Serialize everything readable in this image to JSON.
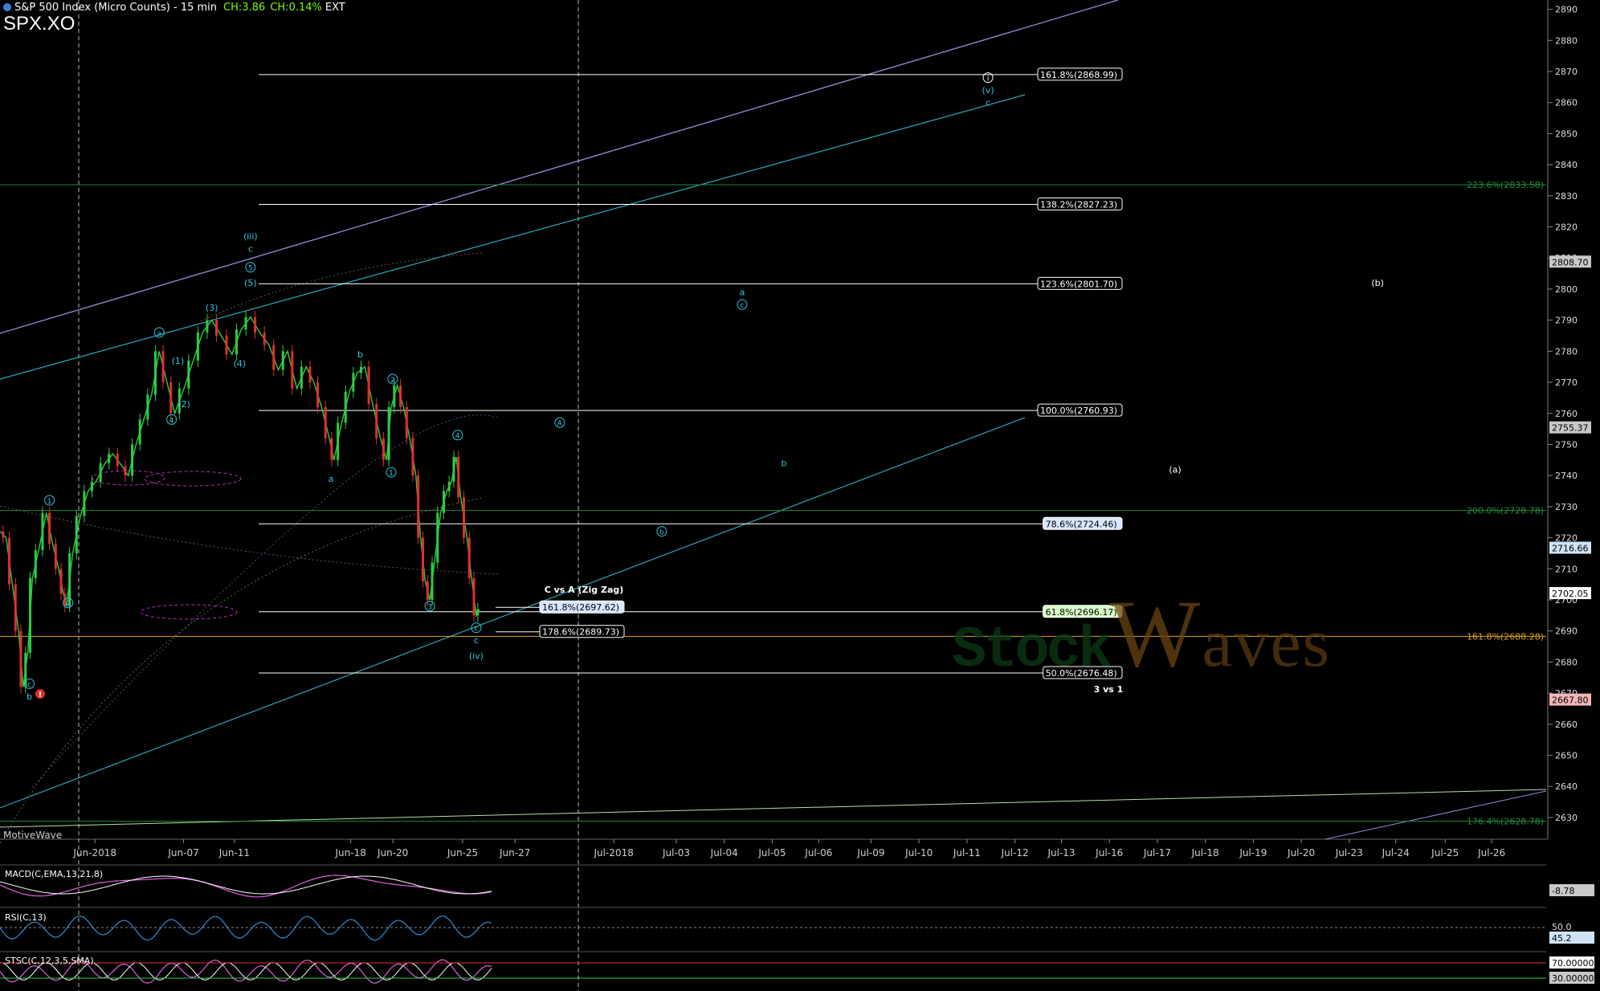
{
  "header": {
    "title": "S&P 500 Index (Micro Counts) - 15 min",
    "change": "CH:3.86",
    "change_pct": "CH:0.14%",
    "session": "EXT",
    "symbol": "SPX.XO"
  },
  "watermark": "MotiveWave",
  "brand": {
    "part1": "Stock",
    "part2": "aves",
    "w": "W"
  },
  "colors": {
    "up": "#2ecc40",
    "down": "#e0302a",
    "wave": "#2ec7e0",
    "fib": "#ffffff",
    "green_line": "#1f8c3a",
    "orange_line": "#d9a21b"
  },
  "chart_data": {
    "type": "line",
    "title": "S&P 500 Index (Micro Counts) - 15 min",
    "ylim": [
      2623,
      2893
    ],
    "y_ticks": [
      2630,
      2640,
      2650,
      2660,
      2670,
      2680,
      2690,
      2700,
      2710,
      2720,
      2730,
      2740,
      2750,
      2760,
      2770,
      2780,
      2790,
      2800,
      2810,
      2820,
      2830,
      2840,
      2850,
      2860,
      2870,
      2880,
      2890
    ],
    "x_ticks": [
      "Jun-2018",
      "Jun-07",
      "Jun-11",
      "Jun-18",
      "Jun-20",
      "Jun-25",
      "Jun-27",
      "Jul-2018",
      "Jul-03",
      "Jul-04",
      "Jul-05",
      "Jul-06",
      "Jul-09",
      "Jul-10",
      "Jul-11",
      "Jul-12",
      "Jul-13",
      "Jul-16",
      "Jul-17",
      "Jul-18",
      "Jul-19",
      "Jul-20",
      "Jul-23",
      "Jul-24",
      "Jul-25",
      "Jul-26"
    ],
    "price_path": [
      [
        0.0,
        2722
      ],
      [
        0.004,
        2720
      ],
      [
        0.008,
        2705
      ],
      [
        0.012,
        2690
      ],
      [
        0.015,
        2672
      ],
      [
        0.018,
        2683
      ],
      [
        0.021,
        2707
      ],
      [
        0.025,
        2716
      ],
      [
        0.03,
        2728
      ],
      [
        0.034,
        2718
      ],
      [
        0.038,
        2710
      ],
      [
        0.041,
        2702
      ],
      [
        0.043,
        2698
      ],
      [
        0.047,
        2715
      ],
      [
        0.052,
        2727
      ],
      [
        0.057,
        2735
      ],
      [
        0.062,
        2738
      ],
      [
        0.068,
        2744
      ],
      [
        0.073,
        2747
      ],
      [
        0.079,
        2743
      ],
      [
        0.083,
        2740
      ],
      [
        0.088,
        2750
      ],
      [
        0.093,
        2758
      ],
      [
        0.098,
        2766
      ],
      [
        0.103,
        2780
      ],
      [
        0.108,
        2770
      ],
      [
        0.113,
        2760
      ],
      [
        0.119,
        2768
      ],
      [
        0.125,
        2777
      ],
      [
        0.131,
        2786
      ],
      [
        0.137,
        2790
      ],
      [
        0.143,
        2785
      ],
      [
        0.15,
        2779
      ],
      [
        0.156,
        2787
      ],
      [
        0.162,
        2791
      ],
      [
        0.168,
        2786
      ],
      [
        0.174,
        2782
      ],
      [
        0.18,
        2774
      ],
      [
        0.186,
        2780
      ],
      [
        0.192,
        2768
      ],
      [
        0.198,
        2775
      ],
      [
        0.203,
        2770
      ],
      [
        0.208,
        2762
      ],
      [
        0.213,
        2752
      ],
      [
        0.216,
        2745
      ],
      [
        0.221,
        2757
      ],
      [
        0.226,
        2767
      ],
      [
        0.231,
        2773
      ],
      [
        0.236,
        2775
      ],
      [
        0.241,
        2763
      ],
      [
        0.246,
        2752
      ],
      [
        0.25,
        2745
      ],
      [
        0.253,
        2762
      ],
      [
        0.257,
        2769
      ],
      [
        0.261,
        2762
      ],
      [
        0.265,
        2752
      ],
      [
        0.269,
        2740
      ],
      [
        0.272,
        2720
      ],
      [
        0.275,
        2706
      ],
      [
        0.278,
        2700
      ],
      [
        0.281,
        2712
      ],
      [
        0.285,
        2728
      ],
      [
        0.289,
        2735
      ],
      [
        0.292,
        2738
      ],
      [
        0.295,
        2746
      ],
      [
        0.298,
        2733
      ],
      [
        0.302,
        2720
      ],
      [
        0.305,
        2707
      ],
      [
        0.308,
        2695
      ],
      [
        0.31,
        2697
      ]
    ],
    "fib_levels": [
      {
        "label": "161.8%(2868.99)",
        "value": 2868.99,
        "style": "plain"
      },
      {
        "label": "138.2%(2827.23)",
        "value": 2827.23,
        "style": "plain"
      },
      {
        "label": "123.6%(2801.70)",
        "value": 2801.7,
        "style": "plain"
      },
      {
        "label": "100.0%(2760.93)",
        "value": 2760.93,
        "style": "plain"
      },
      {
        "label": "78.6%(2724.46)",
        "value": 2724.46,
        "style": "blue"
      },
      {
        "label": "61.8%(2696.17)",
        "value": 2696.17,
        "style": "green"
      },
      {
        "label": "50.0%(2676.48)",
        "value": 2676.48,
        "style": "plain"
      },
      {
        "label": "161.8%(2697.62)",
        "value": 2697.62,
        "style": "blue"
      },
      {
        "label": "178.6%(2689.73)",
        "value": 2689.73,
        "style": "plain"
      }
    ],
    "horizontal_labels": [
      {
        "label": "223.6%(2833.58)",
        "value": 2833.58,
        "color": "#1f8c3a"
      },
      {
        "label": "200.0%(2728.78)",
        "value": 2728.78,
        "color": "#1f8c3a"
      },
      {
        "label": "161.8%(2688.28)",
        "value": 2688.28,
        "color": "#d9a21b"
      },
      {
        "label": "176.4%(2628.78)",
        "value": 2628.78,
        "color": "#1f8c3a"
      }
    ],
    "annotations": [
      "C vs A (Zig Zag)",
      "3 vs 1"
    ],
    "price_badges": [
      {
        "label": "2808.70",
        "value": 2808.7,
        "bg": "#c8c8c8"
      },
      {
        "label": "2755.37",
        "value": 2755.37,
        "bg": "#c8c8c8"
      },
      {
        "label": "2716.66",
        "value": 2716.66,
        "bg": "#cfe3f5"
      },
      {
        "label": "2702.05",
        "value": 2702.05,
        "bg": "#ffffff"
      },
      {
        "label": "2667.80",
        "value": 2667.8,
        "bg": "#f3b6b6"
      }
    ],
    "wave_labels": [
      {
        "t": "(iii)",
        "x": 0.162,
        "v": 2816
      },
      {
        "t": "c",
        "x": 0.162,
        "v": 2812
      },
      {
        "t": "⑤",
        "x": 0.162,
        "v": 2806,
        "c": true
      },
      {
        "t": "(5)",
        "x": 0.162,
        "v": 2801
      },
      {
        "t": "(3)",
        "x": 0.137,
        "v": 2793
      },
      {
        "t": "ⓐ",
        "x": 0.103,
        "v": 2785,
        "c": true
      },
      {
        "t": "(1)",
        "x": 0.115,
        "v": 2776
      },
      {
        "t": "(2)",
        "x": 0.119,
        "v": 2762
      },
      {
        "t": "④",
        "x": 0.111,
        "v": 2757,
        "c": true
      },
      {
        "t": "(4)",
        "x": 0.155,
        "v": 2775
      },
      {
        "t": "b",
        "x": 0.233,
        "v": 2778
      },
      {
        "t": "②",
        "x": 0.254,
        "v": 2770,
        "c": true
      },
      {
        "t": "a",
        "x": 0.214,
        "v": 2738
      },
      {
        "t": "①",
        "x": 0.253,
        "v": 2740,
        "c": true
      },
      {
        "t": "④",
        "x": 0.296,
        "v": 2752,
        "c": true
      },
      {
        "t": "③",
        "x": 0.278,
        "v": 2697,
        "c": true
      },
      {
        "t": "①",
        "x": 0.032,
        "v": 2731,
        "c": true
      },
      {
        "t": "②",
        "x": 0.044,
        "v": 2698,
        "c": true
      },
      {
        "t": "ⓒ",
        "x": 0.019,
        "v": 2672,
        "c": true
      },
      {
        "t": "b",
        "x": 0.019,
        "v": 2668
      },
      {
        "t": "ⓒ",
        "x": 0.308,
        "v": 2690,
        "c": true
      },
      {
        "t": "c",
        "x": 0.308,
        "v": 2686
      },
      {
        "t": "(iv)",
        "x": 0.308,
        "v": 2681
      },
      {
        "t": "Ⓐ",
        "x": 0.362,
        "v": 2756,
        "c": true
      },
      {
        "t": "a",
        "x": 0.48,
        "v": 2798
      },
      {
        "t": "ⓒ",
        "x": 0.48,
        "v": 2794,
        "c": true
      },
      {
        "t": "b",
        "x": 0.507,
        "v": 2743
      },
      {
        "t": "ⓑ",
        "x": 0.428,
        "v": 2721,
        "c": true
      },
      {
        "t": "(v)",
        "x": 0.639,
        "v": 2863
      },
      {
        "t": "c",
        "x": 0.639,
        "v": 2859
      },
      {
        "t": "(a)",
        "x": 0.76,
        "v": 2741
      },
      {
        "t": "(b)",
        "x": 0.891,
        "v": 2801
      }
    ],
    "circle_i": {
      "t": "i",
      "x": 0.639,
      "v": 2867
    },
    "indicators": [
      {
        "name": "MACD(C,EMA,13,21,8)",
        "badge": "-8.78"
      },
      {
        "name": "RSI(C,13)",
        "level_label": "50.0",
        "badge": "45.2"
      },
      {
        "name": "STSC(C,12,3,5,SMA)",
        "badge": "70.00000",
        "badge2": "30.00000"
      }
    ]
  }
}
